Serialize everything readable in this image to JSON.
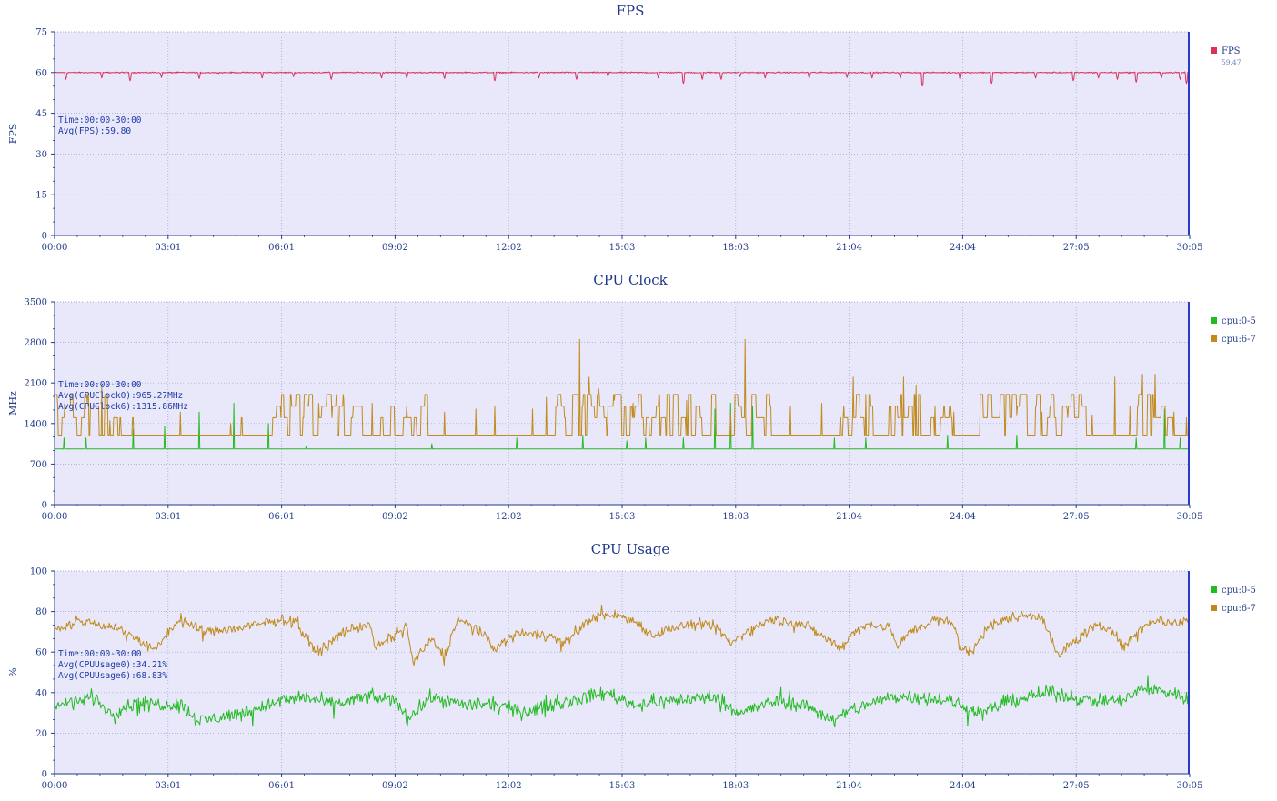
{
  "chart_data": [
    {
      "type": "line",
      "title": "FPS",
      "ylabel": "FPS",
      "ylim": [
        0,
        75
      ],
      "yticks": [
        "0",
        "15",
        "30",
        "45",
        "60",
        "75"
      ],
      "xticks": [
        "00:00",
        "03:01",
        "06:01",
        "09:02",
        "12:02",
        "15:03",
        "18:03",
        "21:04",
        "24:04",
        "27:05",
        "30:05"
      ],
      "xlim_seconds": [
        0,
        1805
      ],
      "grid": true,
      "legend_position": "right",
      "annotation": [
        "Time:00:00-30:00",
        "Avg(FPS):59.80"
      ],
      "series": [
        {
          "name": "FPS",
          "value_label": "59.47",
          "color": "#d9335c",
          "baseline": 60,
          "noise": 0.35,
          "dips": [
            [
              18,
              57.5
            ],
            [
              75,
              58
            ],
            [
              120,
              57
            ],
            [
              170,
              58.2
            ],
            [
              230,
              57.8
            ],
            [
              330,
              58
            ],
            [
              380,
              58.5
            ],
            [
              440,
              57.5
            ],
            [
              520,
              58
            ],
            [
              560,
              58
            ],
            [
              620,
              57.8
            ],
            [
              700,
              57
            ],
            [
              770,
              58
            ],
            [
              830,
              57.5
            ],
            [
              880,
              58.5
            ],
            [
              960,
              58
            ],
            [
              1000,
              56
            ],
            [
              1030,
              57.5
            ],
            [
              1060,
              57.5
            ],
            [
              1090,
              58.5
            ],
            [
              1130,
              58
            ],
            [
              1200,
              58
            ],
            [
              1260,
              58.2
            ],
            [
              1300,
              58
            ],
            [
              1345,
              58
            ],
            [
              1380,
              55
            ],
            [
              1440,
              57.5
            ],
            [
              1490,
              56
            ],
            [
              1560,
              58
            ],
            [
              1620,
              57
            ],
            [
              1660,
              58
            ],
            [
              1690,
              57.5
            ],
            [
              1720,
              56.5
            ],
            [
              1760,
              58
            ],
            [
              1790,
              57.5
            ],
            [
              1800,
              56
            ]
          ]
        }
      ]
    },
    {
      "type": "line",
      "title": "CPU Clock",
      "ylabel": "MHz",
      "ylim": [
        0,
        3500
      ],
      "yticks": [
        "0",
        "700",
        "1400",
        "2100",
        "2800",
        "3500"
      ],
      "xticks": [
        "00:00",
        "03:01",
        "06:01",
        "09:02",
        "12:02",
        "15:03",
        "18:03",
        "21:04",
        "24:04",
        "27:05",
        "30:05"
      ],
      "xlim_seconds": [
        0,
        1805
      ],
      "grid": true,
      "legend_position": "right",
      "annotation": [
        "Time:00:00-30:00",
        "Avg(CPUClock0):965.27MHz",
        "Avg(CPUClock6):1315.86MHz"
      ],
      "series": [
        {
          "name": "cpu:0-5",
          "color": "#22bb22",
          "baseline": 960,
          "spikes": [
            [
              15,
              1150
            ],
            [
              50,
              1150
            ],
            [
              125,
              1300
            ],
            [
              175,
              1350
            ],
            [
              230,
              1600
            ],
            [
              285,
              1750
            ],
            [
              340,
              1400
            ],
            [
              400,
              1000
            ],
            [
              600,
              1050
            ],
            [
              735,
              1150
            ],
            [
              840,
              1200
            ],
            [
              910,
              1100
            ],
            [
              940,
              1150
            ],
            [
              1000,
              1150
            ],
            [
              1050,
              1650
            ],
            [
              1075,
              1750
            ],
            [
              1110,
              1700
            ],
            [
              1240,
              1150
            ],
            [
              1290,
              1150
            ],
            [
              1420,
              1200
            ],
            [
              1530,
              1200
            ],
            [
              1720,
              1150
            ],
            [
              1765,
              1650
            ],
            [
              1790,
              1150
            ]
          ]
        },
        {
          "name": "cpu:6-7",
          "color": "#c08a1c",
          "baseline": 1200,
          "levels": [
            1500,
            1700,
            1900
          ],
          "busy": [
            [
              0,
              95
            ],
            [
              330,
              490
            ],
            [
              515,
              600
            ],
            [
              795,
              1045
            ],
            [
              1080,
              1145
            ],
            [
              1255,
              1440
            ],
            [
              1460,
              1640
            ],
            [
              1720,
              1790
            ]
          ],
          "peaks": [
            [
              5,
              1700
            ],
            [
              52,
              1750
            ],
            [
              75,
              2050
            ],
            [
              88,
              1450
            ],
            [
              200,
              1600
            ],
            [
              280,
              1400
            ],
            [
              360,
              1500
            ],
            [
              420,
              1750
            ],
            [
              440,
              1900
            ],
            [
              460,
              1800
            ],
            [
              505,
              1750
            ],
            [
              560,
              1700
            ],
            [
              620,
              1600
            ],
            [
              670,
              1650
            ],
            [
              700,
              1700
            ],
            [
              760,
              1650
            ],
            [
              782,
              1850
            ],
            [
              835,
              2050
            ],
            [
              850,
              2200
            ],
            [
              835,
              2850
            ],
            [
              865,
              2000
            ],
            [
              890,
              1800
            ],
            [
              920,
              1750
            ],
            [
              960,
              1700
            ],
            [
              1005,
              1800
            ],
            [
              1025,
              1700
            ],
            [
              1075,
              1600
            ],
            [
              1098,
              2850
            ],
            [
              1170,
              1700
            ],
            [
              1220,
              1750
            ],
            [
              1255,
              1700
            ],
            [
              1270,
              2200
            ],
            [
              1290,
              1900
            ],
            [
              1350,
              2200
            ],
            [
              1370,
              2050
            ],
            [
              1400,
              1700
            ],
            [
              1430,
              1600
            ],
            [
              1480,
              1500
            ],
            [
              1530,
              1550
            ],
            [
              1570,
              1600
            ],
            [
              1610,
              1650
            ],
            [
              1650,
              1550
            ],
            [
              1686,
              2200
            ],
            [
              1710,
              1700
            ],
            [
              1730,
              2250
            ],
            [
              1750,
              2250
            ],
            [
              1780,
              1600
            ],
            [
              1800,
              1500
            ]
          ]
        }
      ]
    },
    {
      "type": "line",
      "title": "CPU Usage",
      "ylabel": "%",
      "ylim": [
        0,
        100
      ],
      "yticks": [
        "0",
        "20",
        "40",
        "60",
        "80",
        "100"
      ],
      "xticks": [
        "00:00",
        "03:01",
        "06:01",
        "09:02",
        "12:02",
        "15:03",
        "18:03",
        "21:04",
        "24:04",
        "27:05",
        "30:05"
      ],
      "xlim_seconds": [
        0,
        1805
      ],
      "grid": true,
      "legend_position": "right",
      "annotation": [
        "Time:00:00-30:00",
        "Avg(CPUUsage0):34.21%",
        "Avg(CPUUsage6):68.83%"
      ],
      "series": [
        {
          "name": "cpu:0-5",
          "color": "#22bb22",
          "baseline": 34,
          "noise": 3.2,
          "anchors": [
            [
              0,
              33
            ],
            [
              60,
              38
            ],
            [
              90,
              30
            ],
            [
              130,
              35
            ],
            [
              200,
              34
            ],
            [
              230,
              26
            ],
            [
              300,
              30
            ],
            [
              360,
              36
            ],
            [
              400,
              38
            ],
            [
              440,
              34
            ],
            [
              500,
              38
            ],
            [
              545,
              36
            ],
            [
              560,
              27
            ],
            [
              600,
              38
            ],
            [
              650,
              34
            ],
            [
              700,
              34
            ],
            [
              745,
              30
            ],
            [
              790,
              34
            ],
            [
              850,
              38
            ],
            [
              880,
              40
            ],
            [
              920,
              34
            ],
            [
              980,
              36
            ],
            [
              1050,
              38
            ],
            [
              1090,
              30
            ],
            [
              1150,
              36
            ],
            [
              1200,
              33
            ],
            [
              1240,
              26
            ],
            [
              1270,
              32
            ],
            [
              1330,
              38
            ],
            [
              1380,
              38
            ],
            [
              1420,
              36
            ],
            [
              1475,
              30
            ],
            [
              1520,
              36
            ],
            [
              1580,
              40
            ],
            [
              1650,
              36
            ],
            [
              1700,
              36
            ],
            [
              1730,
              42
            ],
            [
              1780,
              40
            ],
            [
              1805,
              36
            ]
          ]
        },
        {
          "name": "cpu:6-7",
          "color": "#c08a1c",
          "baseline": 72,
          "noise": 2.4,
          "anchors": [
            [
              0,
              72
            ],
            [
              50,
              75
            ],
            [
              100,
              72
            ],
            [
              140,
              65
            ],
            [
              160,
              60
            ],
            [
              180,
              70
            ],
            [
              200,
              76
            ],
            [
              240,
              70
            ],
            [
              300,
              72
            ],
            [
              360,
              76
            ],
            [
              385,
              75
            ],
            [
              400,
              66
            ],
            [
              420,
              60
            ],
            [
              460,
              70
            ],
            [
              500,
              74
            ],
            [
              510,
              62
            ],
            [
              540,
              68
            ],
            [
              560,
              72
            ],
            [
              570,
              55
            ],
            [
              600,
              66
            ],
            [
              620,
              58
            ],
            [
              640,
              76
            ],
            [
              670,
              72
            ],
            [
              700,
              62
            ],
            [
              740,
              70
            ],
            [
              790,
              68
            ],
            [
              810,
              64
            ],
            [
              830,
              70
            ],
            [
              860,
              78
            ],
            [
              900,
              78
            ],
            [
              930,
              74
            ],
            [
              950,
              68
            ],
            [
              980,
              72
            ],
            [
              1030,
              74
            ],
            [
              1060,
              70
            ],
            [
              1075,
              64
            ],
            [
              1100,
              70
            ],
            [
              1140,
              76
            ],
            [
              1190,
              74
            ],
            [
              1230,
              66
            ],
            [
              1250,
              62
            ],
            [
              1270,
              70
            ],
            [
              1300,
              74
            ],
            [
              1330,
              72
            ],
            [
              1340,
              62
            ],
            [
              1360,
              70
            ],
            [
              1400,
              76
            ],
            [
              1430,
              74
            ],
            [
              1440,
              62
            ],
            [
              1460,
              60
            ],
            [
              1480,
              72
            ],
            [
              1530,
              78
            ],
            [
              1570,
              78
            ],
            [
              1595,
              58
            ],
            [
              1620,
              65
            ],
            [
              1650,
              72
            ],
            [
              1680,
              72
            ],
            [
              1700,
              62
            ],
            [
              1720,
              70
            ],
            [
              1750,
              76
            ],
            [
              1790,
              74
            ],
            [
              1805,
              76
            ]
          ]
        }
      ]
    }
  ]
}
